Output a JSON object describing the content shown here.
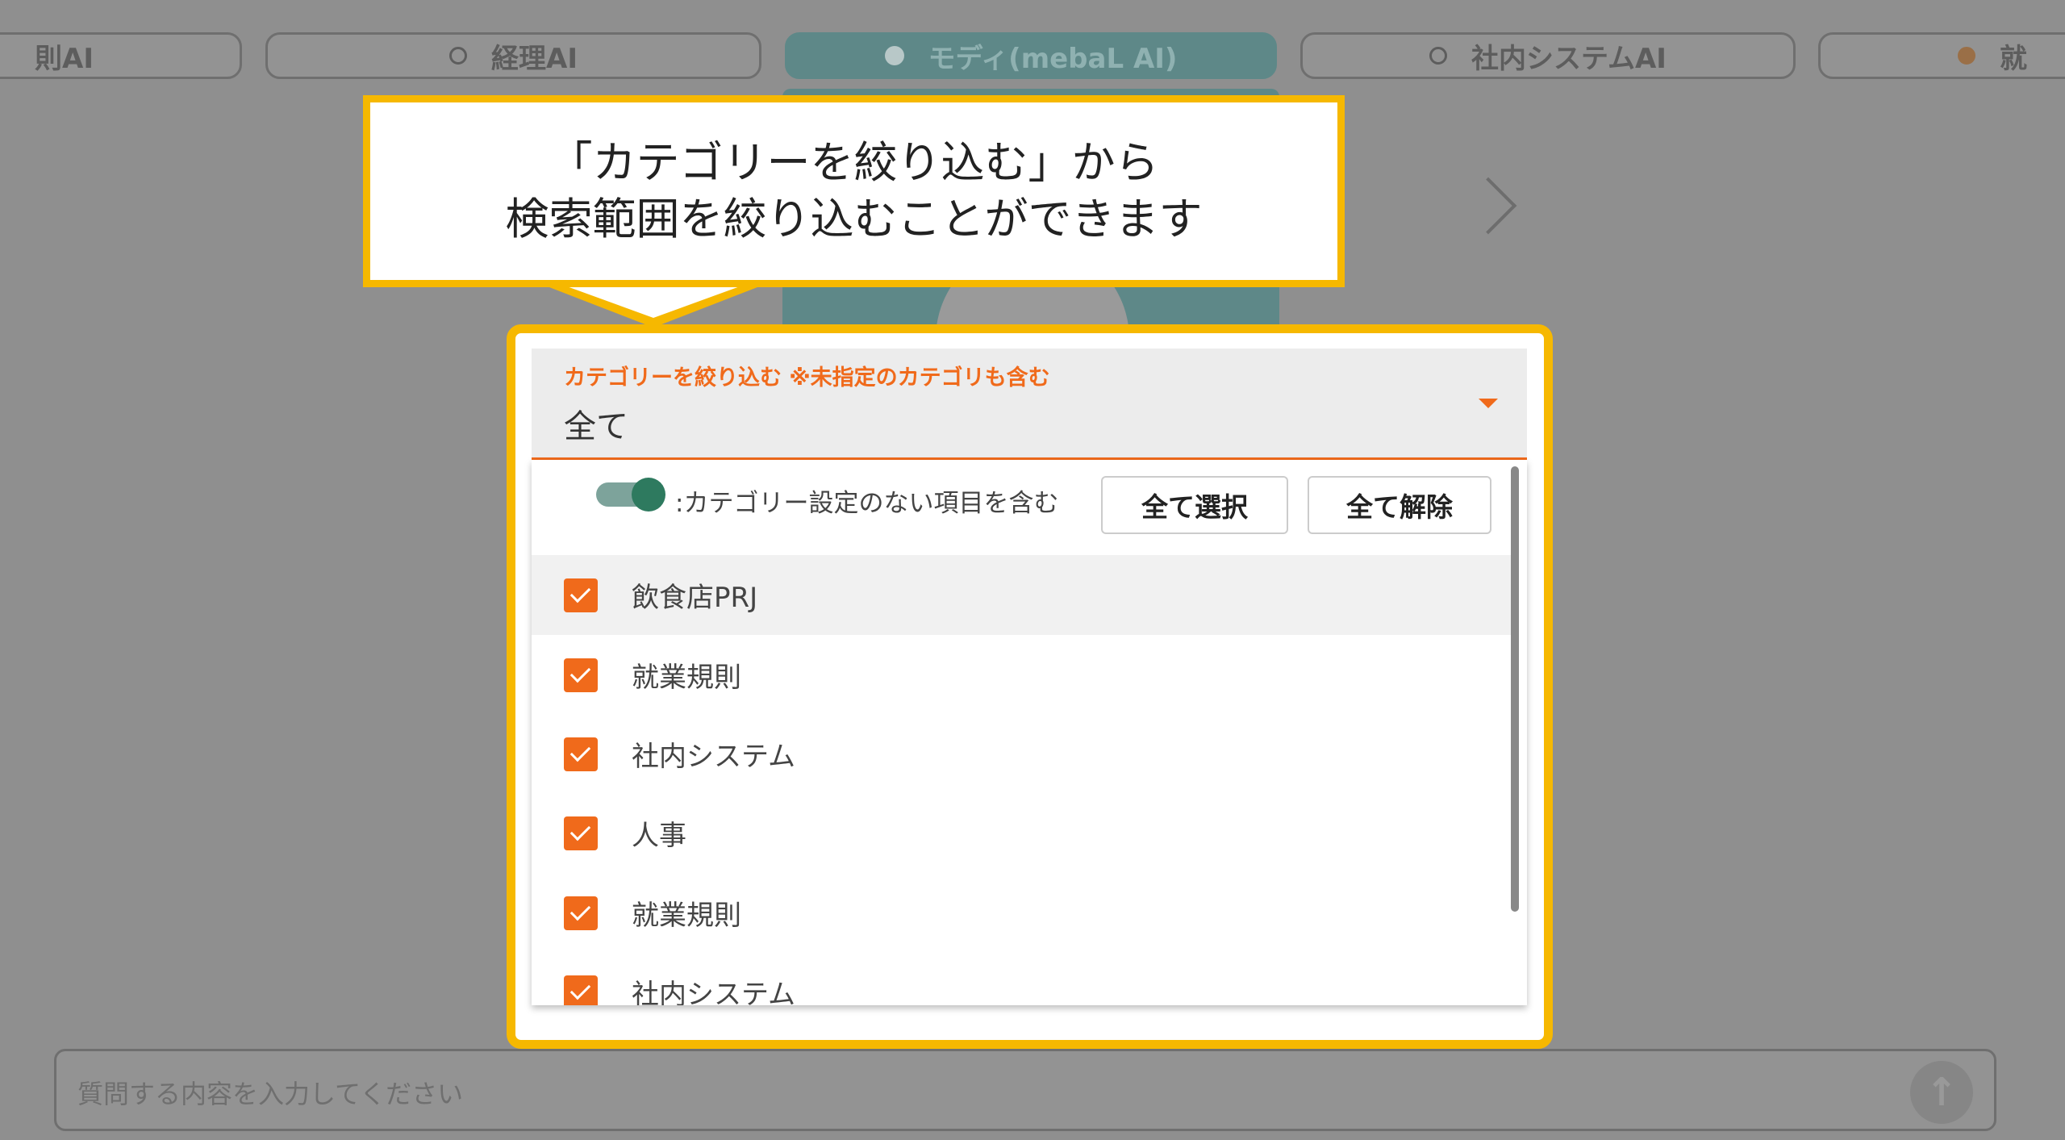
{
  "tabs": [
    {
      "label": "則AI"
    },
    {
      "label": "経理AI"
    },
    {
      "label": "モディ(mebaL AI)"
    },
    {
      "label": "社内システムAI"
    },
    {
      "label": "就"
    }
  ],
  "callout": {
    "line1": "「カテゴリーを絞り込む」から",
    "line2": "検索範囲を絞り込むことができます"
  },
  "filter": {
    "label": "カテゴリーを絞り込む ※未指定のカテゴリも含む",
    "value": "全て",
    "toggle_label": ":カテゴリー設定のない項目を含む",
    "toggle_on": true,
    "select_all_label": "全て選択",
    "clear_all_label": "全て解除",
    "items": [
      {
        "label": "飲食店PRJ",
        "checked": true
      },
      {
        "label": "就業規則",
        "checked": true
      },
      {
        "label": "社内システム",
        "checked": true
      },
      {
        "label": "人事",
        "checked": true
      },
      {
        "label": "就業規則",
        "checked": true
      },
      {
        "label": "社内システム",
        "checked": true
      }
    ]
  },
  "chat": {
    "placeholder": "質問する内容を入力してください"
  },
  "colors": {
    "accent": "#f06a1b",
    "highlight": "#f6b800",
    "teal": "#5e8888"
  }
}
